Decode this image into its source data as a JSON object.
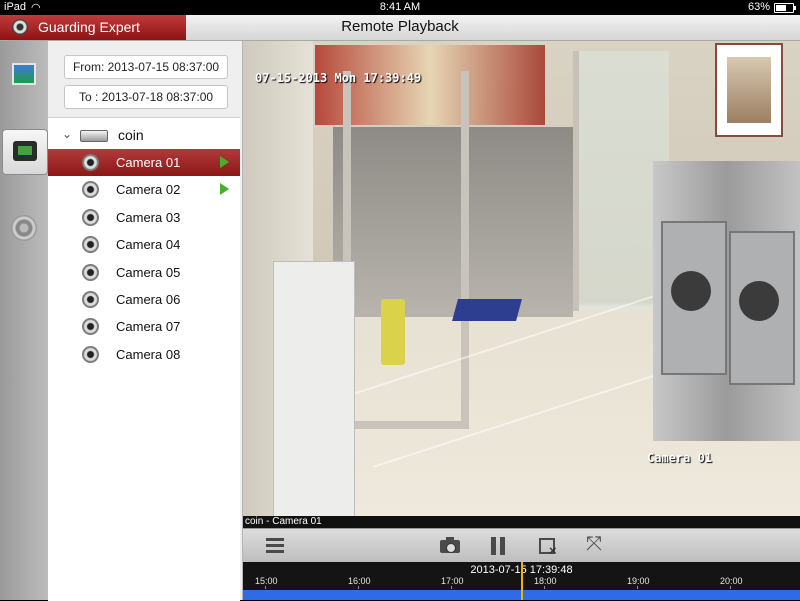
{
  "status_bar": {
    "device": "iPad",
    "time": "8:41 AM",
    "battery": "63%",
    "battery_level": 0.63
  },
  "header": {
    "app_name": "Guarding Expert",
    "title": "Remote Playback"
  },
  "search": {
    "from_label": "From: 2013-07-15 08:37:00",
    "to_label": "To  : 2013-07-18 08:37:00"
  },
  "device": {
    "name": "coin",
    "cameras": [
      {
        "label": "Camera 01",
        "selected": true,
        "has_record": true
      },
      {
        "label": "Camera 02",
        "selected": false,
        "has_record": true
      },
      {
        "label": "Camera 03",
        "selected": false,
        "has_record": false
      },
      {
        "label": "Camera 04",
        "selected": false,
        "has_record": false
      },
      {
        "label": "Camera 05",
        "selected": false,
        "has_record": false
      },
      {
        "label": "Camera 06",
        "selected": false,
        "has_record": false
      },
      {
        "label": "Camera 07",
        "selected": false,
        "has_record": false
      },
      {
        "label": "Camera 08",
        "selected": false,
        "has_record": false
      }
    ]
  },
  "video": {
    "osd_time": "07-15-2013 Mon 17:39:49",
    "osd_camera": "Camera 01",
    "label": "coin - Camera 01"
  },
  "toolbar": {
    "icons": [
      "list-icon",
      "camera-capture-icon",
      "pause-icon",
      "stop-clip-icon",
      "fullscreen-icon"
    ]
  },
  "timeline": {
    "current_time": "2013-07-15 17:39:48",
    "ticks": [
      "15:00",
      "16:00",
      "17:00",
      "18:00",
      "19:00",
      "20:00"
    ]
  },
  "colors": {
    "accent_red": "#9b2222",
    "play_green": "#45b02c",
    "timeline_blue": "#2f6be5",
    "cursor_yellow": "#f0b400"
  }
}
